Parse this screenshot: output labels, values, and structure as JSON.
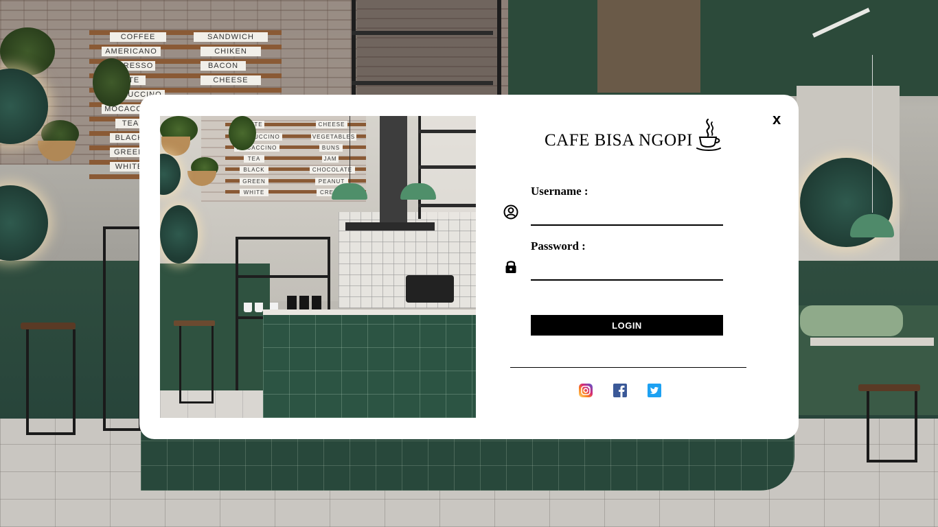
{
  "background": {
    "menu_left": [
      "COFFEE",
      "AMERICANO",
      "ESPRESSO",
      "LATTE",
      "CAPPUCCINO",
      "MOCACCINO",
      "TEA",
      "BLACK",
      "GREEN",
      "WHITE"
    ],
    "menu_right": [
      "SANDWICH",
      "CHIKEN",
      "BACON",
      "CHEESE"
    ]
  },
  "photo": {
    "menu_left": [
      "LATTE",
      "CAPPUCCINO",
      "MOCACCINO",
      "TEA",
      "BLACK",
      "GREEN",
      "WHITE"
    ],
    "menu_right": [
      "CHEESE",
      "VEGETABLES",
      "BUNS",
      "JAM",
      "CHOCOLATE",
      "PEANUT",
      "CREAM"
    ]
  },
  "dialog": {
    "close_label": "x",
    "brand": "CAFE BISA NGOPI",
    "brand_icon": "coffee-cup-icon",
    "username_label": "Username :",
    "username_value": "",
    "password_label": "Password :",
    "password_value": "",
    "login_label": "LOGIN",
    "icons": {
      "username": "user-circle-icon",
      "password": "lock-icon"
    }
  },
  "social": [
    {
      "name": "instagram-icon",
      "color": "#c13584"
    },
    {
      "name": "facebook-icon",
      "color": "#3b5998"
    },
    {
      "name": "twitter-icon",
      "color": "#1da1f2"
    }
  ],
  "colors": {
    "modal_bg": "#ffffff",
    "button_bg": "#000000",
    "button_text": "#ffffff"
  }
}
